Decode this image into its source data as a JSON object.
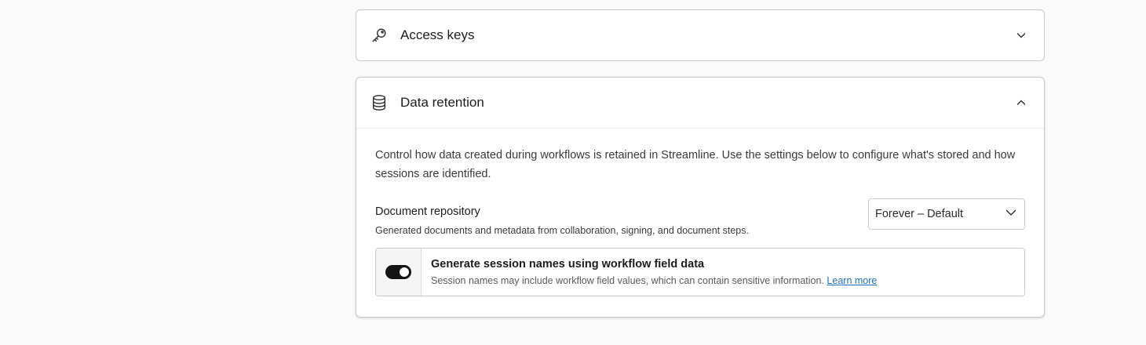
{
  "access_keys": {
    "title": "Access keys",
    "icon": "key-icon",
    "expanded": false
  },
  "data_retention": {
    "title": "Data retention",
    "icon": "database-icon",
    "expanded": true,
    "description": "Control how data created during workflows is retained in Streamline. Use the settings below to configure what's stored and how sessions are identified.",
    "document_repository": {
      "label": "Document repository",
      "help": "Generated documents and metadata from collaboration, signing, and document steps.",
      "selected": "Forever – Default"
    },
    "session_names": {
      "title": "Generate session names using workflow field data",
      "help": "Session names may include workflow field values, which can contain sensitive information.",
      "link": "Learn more",
      "enabled": true
    }
  },
  "colors": {
    "border": "#c9c9c9",
    "link": "#1d6fb8",
    "toggle_on": "#141414"
  }
}
